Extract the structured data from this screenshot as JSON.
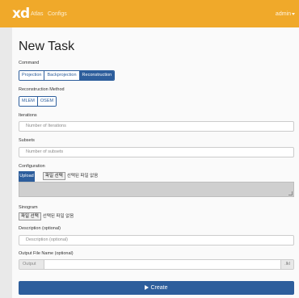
{
  "navbar": {
    "brand": "xd",
    "links": [
      "Atlas",
      "Configs"
    ],
    "user": "admin"
  },
  "page": {
    "title": "New Task"
  },
  "command": {
    "label": "Command",
    "options": [
      "Projection",
      "Backprojection",
      "Reconstruction"
    ],
    "selected": "Reconstruction"
  },
  "reconstruction_method": {
    "label": "Reconstruction Method",
    "options": [
      "MLEM",
      "OSEM"
    ]
  },
  "iterations": {
    "label": "Iterations",
    "placeholder": "Number of Iterations"
  },
  "subsets": {
    "label": "Subsets",
    "placeholder": "Number of subsets"
  },
  "configuration": {
    "label": "Configuration",
    "upload_tab": "Upload",
    "file_button": "파일 선택",
    "file_status": "선택된 파일 없음"
  },
  "sinogram": {
    "label": "Sinogram",
    "file_button": "파일 선택",
    "file_status": "선택된 파일 없음"
  },
  "description": {
    "label": "Description (optional)",
    "placeholder": "Description (optional)"
  },
  "output_file": {
    "label": "Output File Name (optional)",
    "prefix": "Output",
    "suffix": ".lkl"
  },
  "create_button": {
    "label": "Create"
  },
  "colors": {
    "navbar": "#f0a92a",
    "primary": "#2d5e9c",
    "background": "#e9e9e9"
  }
}
